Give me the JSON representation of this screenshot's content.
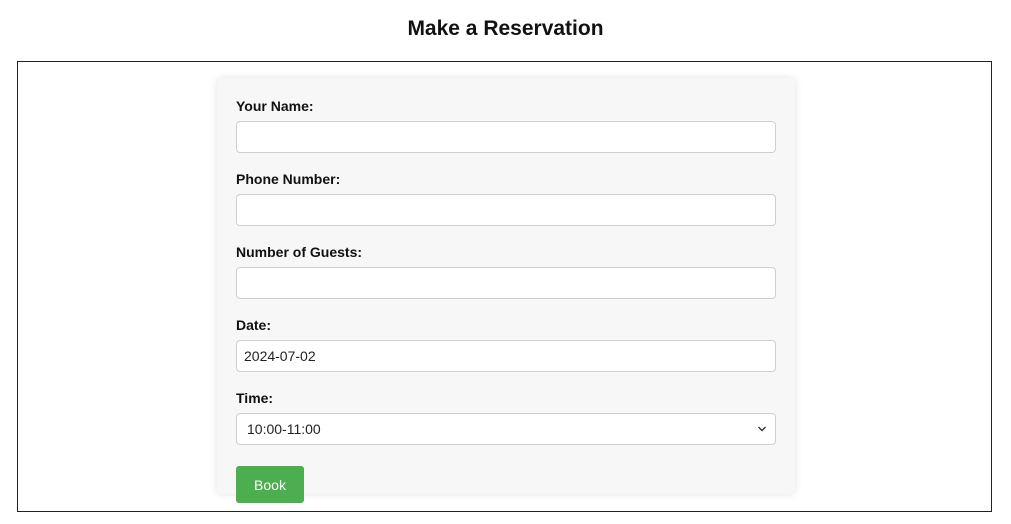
{
  "page": {
    "title": "Make a Reservation"
  },
  "form": {
    "name": {
      "label": "Your Name:",
      "value": ""
    },
    "phone": {
      "label": "Phone Number:",
      "value": ""
    },
    "guests": {
      "label": "Number of Guests:",
      "value": ""
    },
    "date": {
      "label": "Date:",
      "value": "2024-07-02"
    },
    "time": {
      "label": "Time:",
      "selected": "10:00-11:00"
    },
    "submit_label": "Book"
  },
  "colors": {
    "button_bg": "#4cae4f",
    "card_bg": "#f7f7f7"
  }
}
